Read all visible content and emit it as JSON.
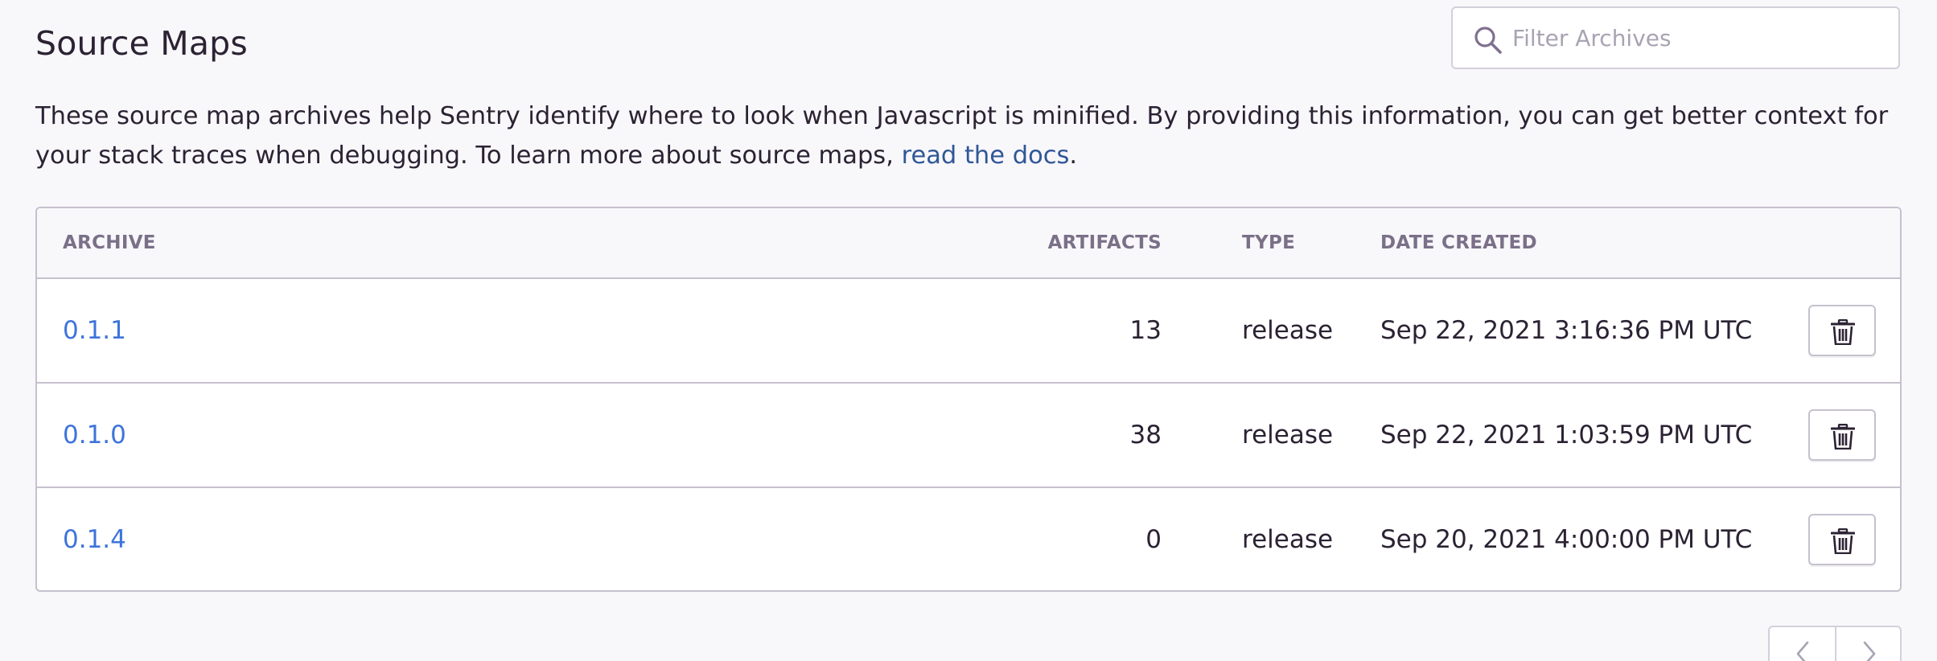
{
  "page": {
    "title": "Source Maps",
    "description_text": "These source map archives help Sentry identify where to look when Javascript is minified. By providing this information, you can get better context for your stack traces when debugging. To learn more about source maps, ",
    "docs_link_label": "read the docs",
    "description_end": "."
  },
  "search": {
    "placeholder": "Filter Archives",
    "value": "",
    "icon": "search-icon"
  },
  "table": {
    "columns": {
      "archive": "ARCHIVE",
      "artifacts": "ARTIFACTS",
      "type": "TYPE",
      "date_created": "DATE CREATED"
    },
    "rows": [
      {
        "name": "0.1.1",
        "artifacts": "13",
        "type": "release",
        "date_created": "Sep 22, 2021 3:16:36 PM UTC"
      },
      {
        "name": "0.1.0",
        "artifacts": "38",
        "type": "release",
        "date_created": "Sep 22, 2021 1:03:59 PM UTC"
      },
      {
        "name": "0.1.4",
        "artifacts": "0",
        "type": "release",
        "date_created": "Sep 20, 2021 4:00:00 PM UTC"
      }
    ],
    "row_action_icon": "trash-icon"
  },
  "pagination": {
    "prev_icon": "chevron-left-icon",
    "next_icon": "chevron-right-icon"
  },
  "colors": {
    "background": "#f8f7fa",
    "text": "#2b2233",
    "link": "#3d74db",
    "docs_link": "#2f5796",
    "header_text": "#7a7088",
    "border": "#c6c1ce"
  }
}
